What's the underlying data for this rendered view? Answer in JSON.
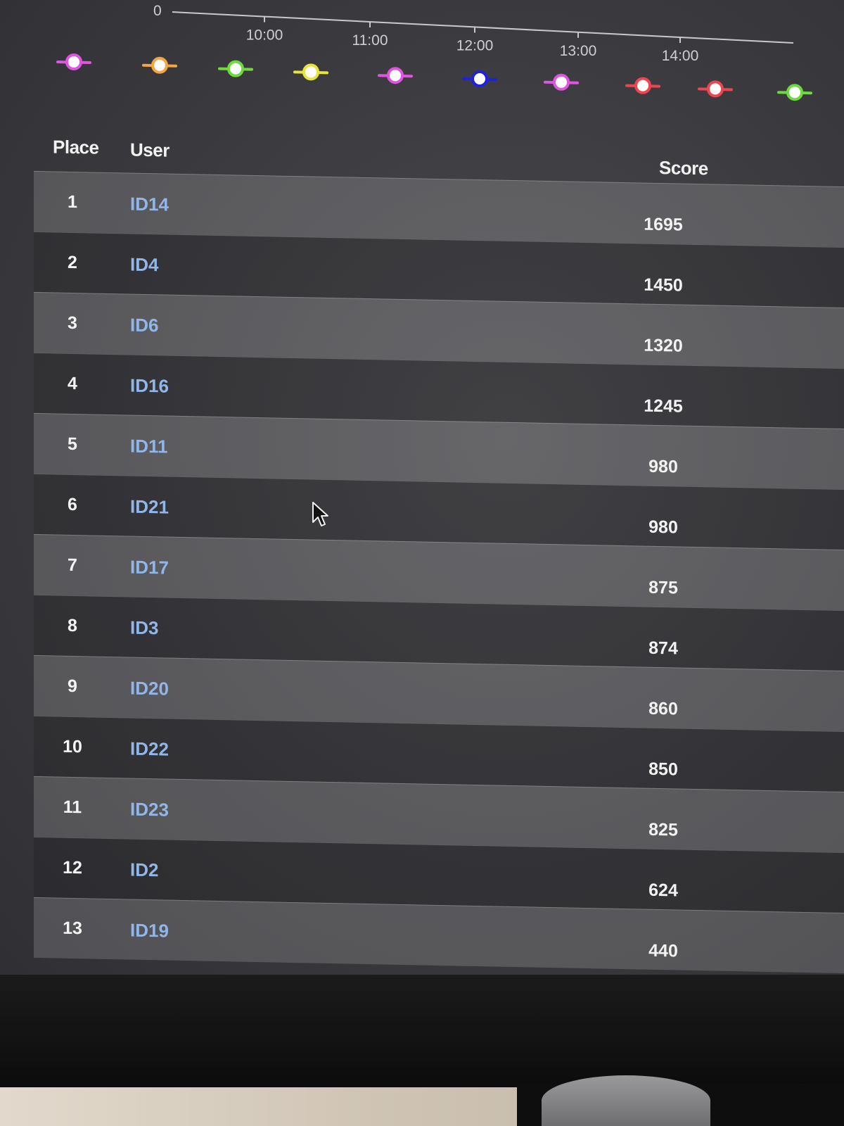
{
  "timeline": {
    "zero_label": "0",
    "time_labels": [
      "10:00",
      "11:00",
      "12:00",
      "13:00",
      "14:00"
    ],
    "markers": [
      {
        "color": "#e055e0",
        "icon": "marker-dot"
      },
      {
        "color": "#f4a640",
        "icon": "marker-dot"
      },
      {
        "color": "#6ddc3a",
        "icon": "marker-dot"
      },
      {
        "color": "#e9e33a",
        "icon": "marker-dot"
      },
      {
        "color": "#e055e0",
        "icon": "marker-dot"
      },
      {
        "color": "#2020e0",
        "icon": "marker-dot"
      },
      {
        "color": "#e055e0",
        "icon": "marker-dot"
      },
      {
        "color": "#f04450",
        "icon": "marker-dot"
      },
      {
        "color": "#f04450",
        "icon": "marker-dot"
      },
      {
        "color": "#6ddc3a",
        "icon": "marker-dot"
      }
    ]
  },
  "table": {
    "headers": {
      "place": "Place",
      "user": "User",
      "score": "Score"
    },
    "rows": [
      {
        "place": "1",
        "user": "ID14",
        "score": "1695"
      },
      {
        "place": "2",
        "user": "ID4",
        "score": "1450"
      },
      {
        "place": "3",
        "user": "ID6",
        "score": "1320"
      },
      {
        "place": "4",
        "user": "ID16",
        "score": "1245"
      },
      {
        "place": "5",
        "user": "ID11",
        "score": "980"
      },
      {
        "place": "6",
        "user": "ID21",
        "score": "980"
      },
      {
        "place": "7",
        "user": "ID17",
        "score": "875"
      },
      {
        "place": "8",
        "user": "ID3",
        "score": "874"
      },
      {
        "place": "9",
        "user": "ID20",
        "score": "860"
      },
      {
        "place": "10",
        "user": "ID22",
        "score": "850"
      },
      {
        "place": "11",
        "user": "ID23",
        "score": "825"
      },
      {
        "place": "12",
        "user": "ID2",
        "score": "624"
      },
      {
        "place": "13",
        "user": "ID19",
        "score": "440"
      }
    ]
  },
  "colors": {
    "user_link": "#8fb7ea",
    "screen_bg": "#3b3b3f"
  }
}
